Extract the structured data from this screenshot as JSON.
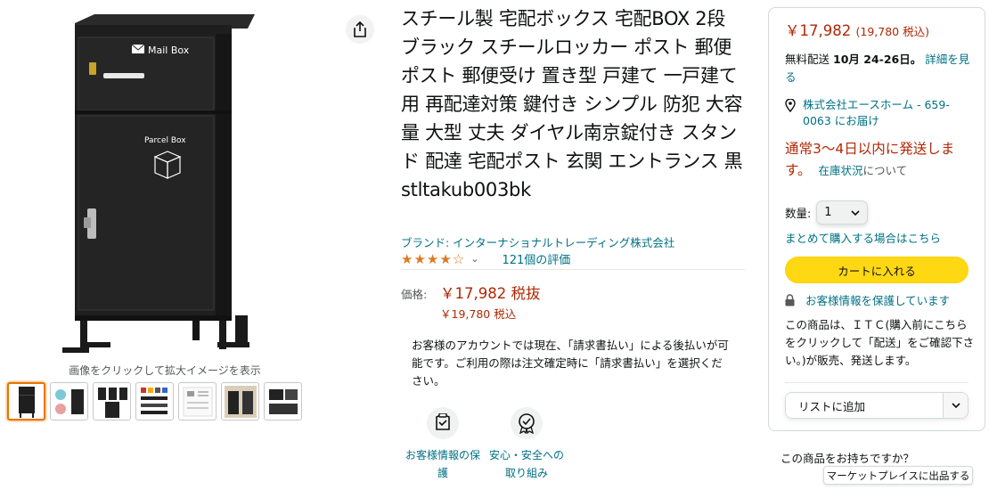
{
  "gallery": {
    "main_image": {
      "mail_label": "Mail Box",
      "parcel_label": "Parcel Box"
    },
    "zoom_hint": "画像をクリックして拡大イメージを表示",
    "thumbnails": [
      "thumb-1",
      "thumb-2",
      "thumb-3",
      "thumb-4",
      "thumb-5",
      "thumb-6",
      "thumb-7"
    ]
  },
  "product": {
    "title": "スチール製 宅配ボックス 宅配BOX 2段 ブラック スチールロッカー ポスト 郵便ポスト 郵便受け 置き型 戸建て 一戸建て用 再配達対策 鍵付き シンプル 防犯 大容量 大型 丈夫 ダイヤル南京錠付き スタンド 配達 宅配ポスト 玄関 エントランス 黒 stltakub003bk",
    "brand": "ブランド: インターナショナルトレーディング株式会社",
    "rating": {
      "value": 4.0,
      "max": 5,
      "stars_display": "★★★★☆",
      "review_count": "121個の評価"
    },
    "price_label": "価格:",
    "price_main": "￥17,982 税抜",
    "price_tax_incl": "￥19,780 税込",
    "invoice_note": "お客様のアカウントでは現在、「請求書払い」による後払いが可能です。ご利用の際は注文確定時に「請求書払い」を選択ください。",
    "badges": [
      {
        "label": "お客様情報の保護",
        "icon": "shield-check-icon"
      },
      {
        "label": "安心・安全への取り組み",
        "icon": "award-check-icon"
      }
    ]
  },
  "buybox": {
    "price": "￥17,982",
    "price_tax_incl": "(19,780 税込)",
    "shipping_prefix": "無料配送",
    "shipping_date": "10月 24-26日。",
    "shipping_link": "詳細を見る",
    "address": "株式会社エースホーム - 659-0063 にお届け",
    "stock_text": "通常3～4日以内に発送します。",
    "stock_link": "在庫状況",
    "stock_suffix": "について",
    "qty_label": "数量:",
    "qty_value": "1",
    "bulk_link": "まとめて購入する場合はこちら",
    "cart_button": "カートに入れる",
    "secure_text": "お客様情報を保護しています",
    "seller_text": "この商品は、ＩＴＣ(購入前にこちらをクリックして「配送」をご確認下さい。)が販売、発送します。",
    "list_button": "リストに追加"
  },
  "sell_section": {
    "question": "この商品をお持ちですか？",
    "button": "マーケットプレイスに出品する"
  },
  "colors": {
    "price": "#b12704",
    "link": "#007185",
    "star": "#de7921",
    "cart_button": "#ffd814"
  }
}
